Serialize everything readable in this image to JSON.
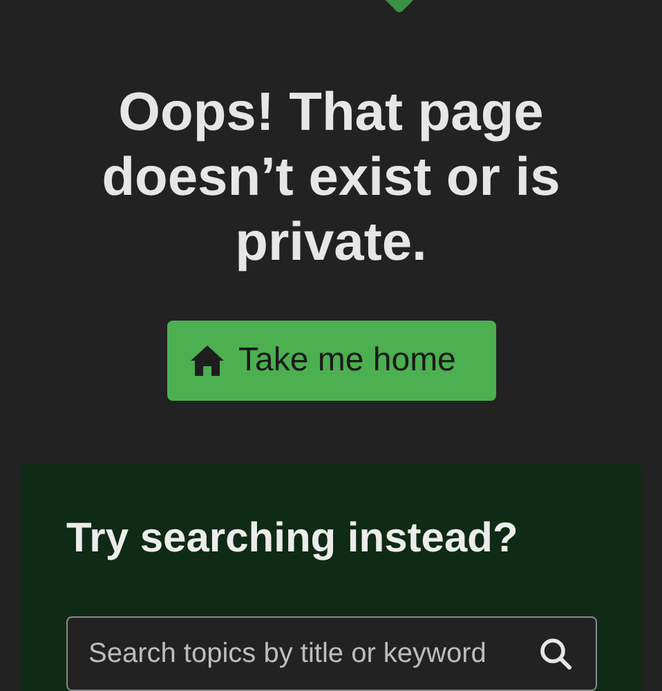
{
  "heading": "Oops! That page doesn’t exist or is private.",
  "home_button": {
    "label": "Take me home"
  },
  "search_card": {
    "title": "Try searching instead?",
    "search": {
      "placeholder": "Search topics by title or keyword"
    }
  }
}
